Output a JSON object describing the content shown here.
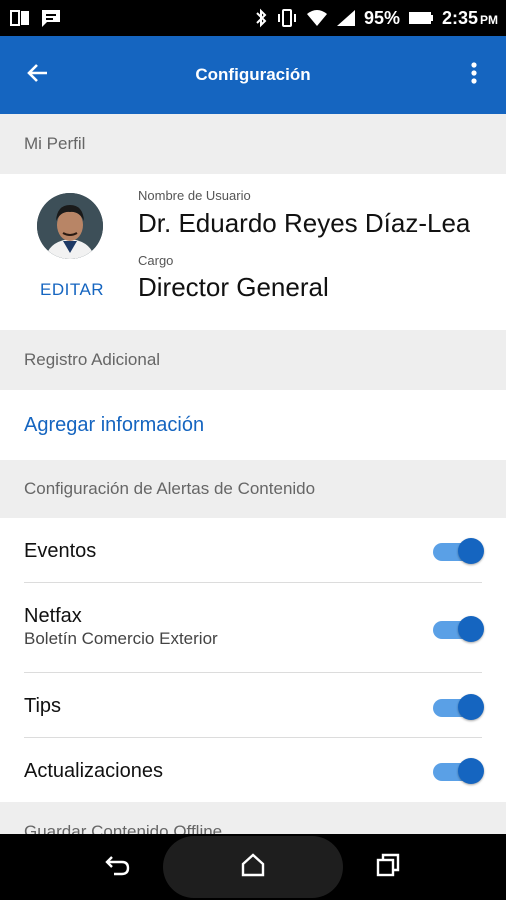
{
  "status_bar": {
    "battery": "95%",
    "time": "2:35",
    "ampm": "PM",
    "icons": [
      "notification-icon",
      "message-icon",
      "bluetooth-icon",
      "vibrate-icon",
      "wifi-icon",
      "signal-icon",
      "battery-icon"
    ]
  },
  "app_bar": {
    "title": "Configuración",
    "back_icon": "arrow-back-icon",
    "more_icon": "more-vert-icon"
  },
  "profile_section": {
    "header": "Mi Perfil",
    "edit_label": "EDITAR",
    "username_label": "Nombre de Usuario",
    "username_value": "Dr. Eduardo Reyes Díaz-Leal",
    "position_label": "Cargo",
    "position_value": "Director General"
  },
  "extra_section": {
    "header": "Registro Adicional",
    "link_label": "Agregar información"
  },
  "alerts_section": {
    "header": "Configuración de Alertas de Contenido",
    "items": [
      {
        "title": "Eventos",
        "subtitle": "",
        "enabled": true
      },
      {
        "title": "Netfax",
        "subtitle": "Boletín Comercio Exterior",
        "enabled": true
      },
      {
        "title": "Tips",
        "subtitle": "",
        "enabled": true
      },
      {
        "title": "Actualizaciones",
        "subtitle": "",
        "enabled": true
      }
    ]
  },
  "offline_section": {
    "header": "Guardar Contenido Offline"
  },
  "colors": {
    "primary": "#1565c0",
    "toggle_track": "#5aa0e6",
    "link": "#1565c0"
  },
  "nav_bar": {
    "icons": [
      "back-nav-icon",
      "home-nav-icon",
      "recents-nav-icon"
    ]
  }
}
